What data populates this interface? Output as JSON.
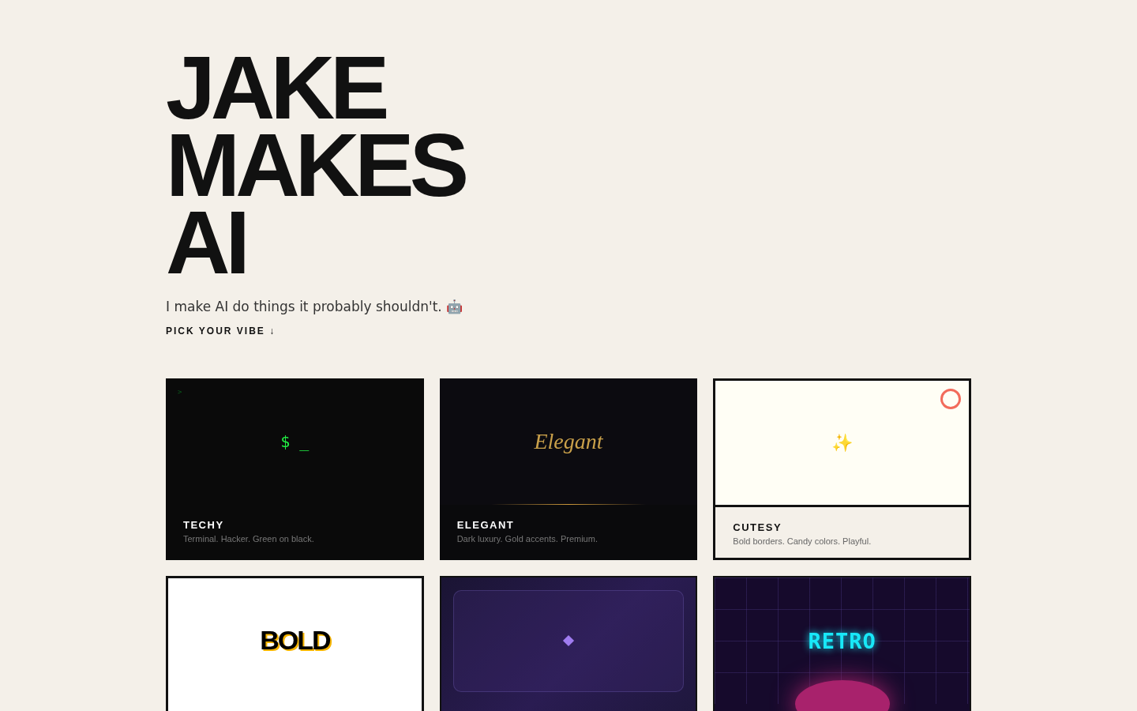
{
  "hero": {
    "title_lines": [
      "JAKE",
      "MAKES",
      "AI"
    ],
    "tagline": "I make AI do things it probably shouldn't. 🤖",
    "cta": "PICK YOUR VIBE ↓"
  },
  "cards": [
    {
      "kind": "techy",
      "prompt": ">",
      "preview": "$ _",
      "title": "TECHY",
      "description": "Terminal. Hacker. Green on black."
    },
    {
      "kind": "elegant",
      "preview": "Elegant",
      "title": "ELEGANT",
      "description": "Dark luxury. Gold accents. Premium."
    },
    {
      "kind": "cutesy",
      "preview": "✨",
      "title": "CUTESY",
      "description": "Bold borders. Candy colors. Playful."
    },
    {
      "kind": "bold",
      "preview": "BOLD"
    },
    {
      "kind": "glass"
    },
    {
      "kind": "retro",
      "preview": "RETRO"
    }
  ]
}
